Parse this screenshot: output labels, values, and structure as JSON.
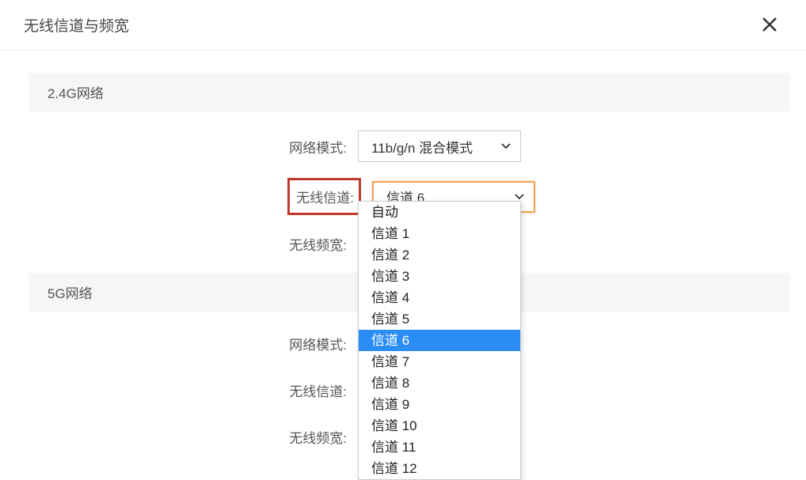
{
  "header": {
    "title": "无线信道与频宽"
  },
  "section24": {
    "title": "2.4G网络",
    "mode": {
      "label": "网络模式:",
      "value": "11b/g/n 混合模式"
    },
    "channel": {
      "label": "无线信道:",
      "value": "信道 6",
      "options": [
        "自动",
        "信道 1",
        "信道 2",
        "信道 3",
        "信道 4",
        "信道 5",
        "信道 6",
        "信道 7",
        "信道 8",
        "信道 9",
        "信道 10",
        "信道 11",
        "信道 12"
      ],
      "selected_index": 6
    },
    "bandwidth": {
      "label": "无线频宽:"
    }
  },
  "section5g": {
    "title": "5G网络",
    "mode": {
      "label": "网络模式:"
    },
    "channel": {
      "label": "无线信道:"
    },
    "bandwidth": {
      "label": "无线频宽:"
    }
  }
}
